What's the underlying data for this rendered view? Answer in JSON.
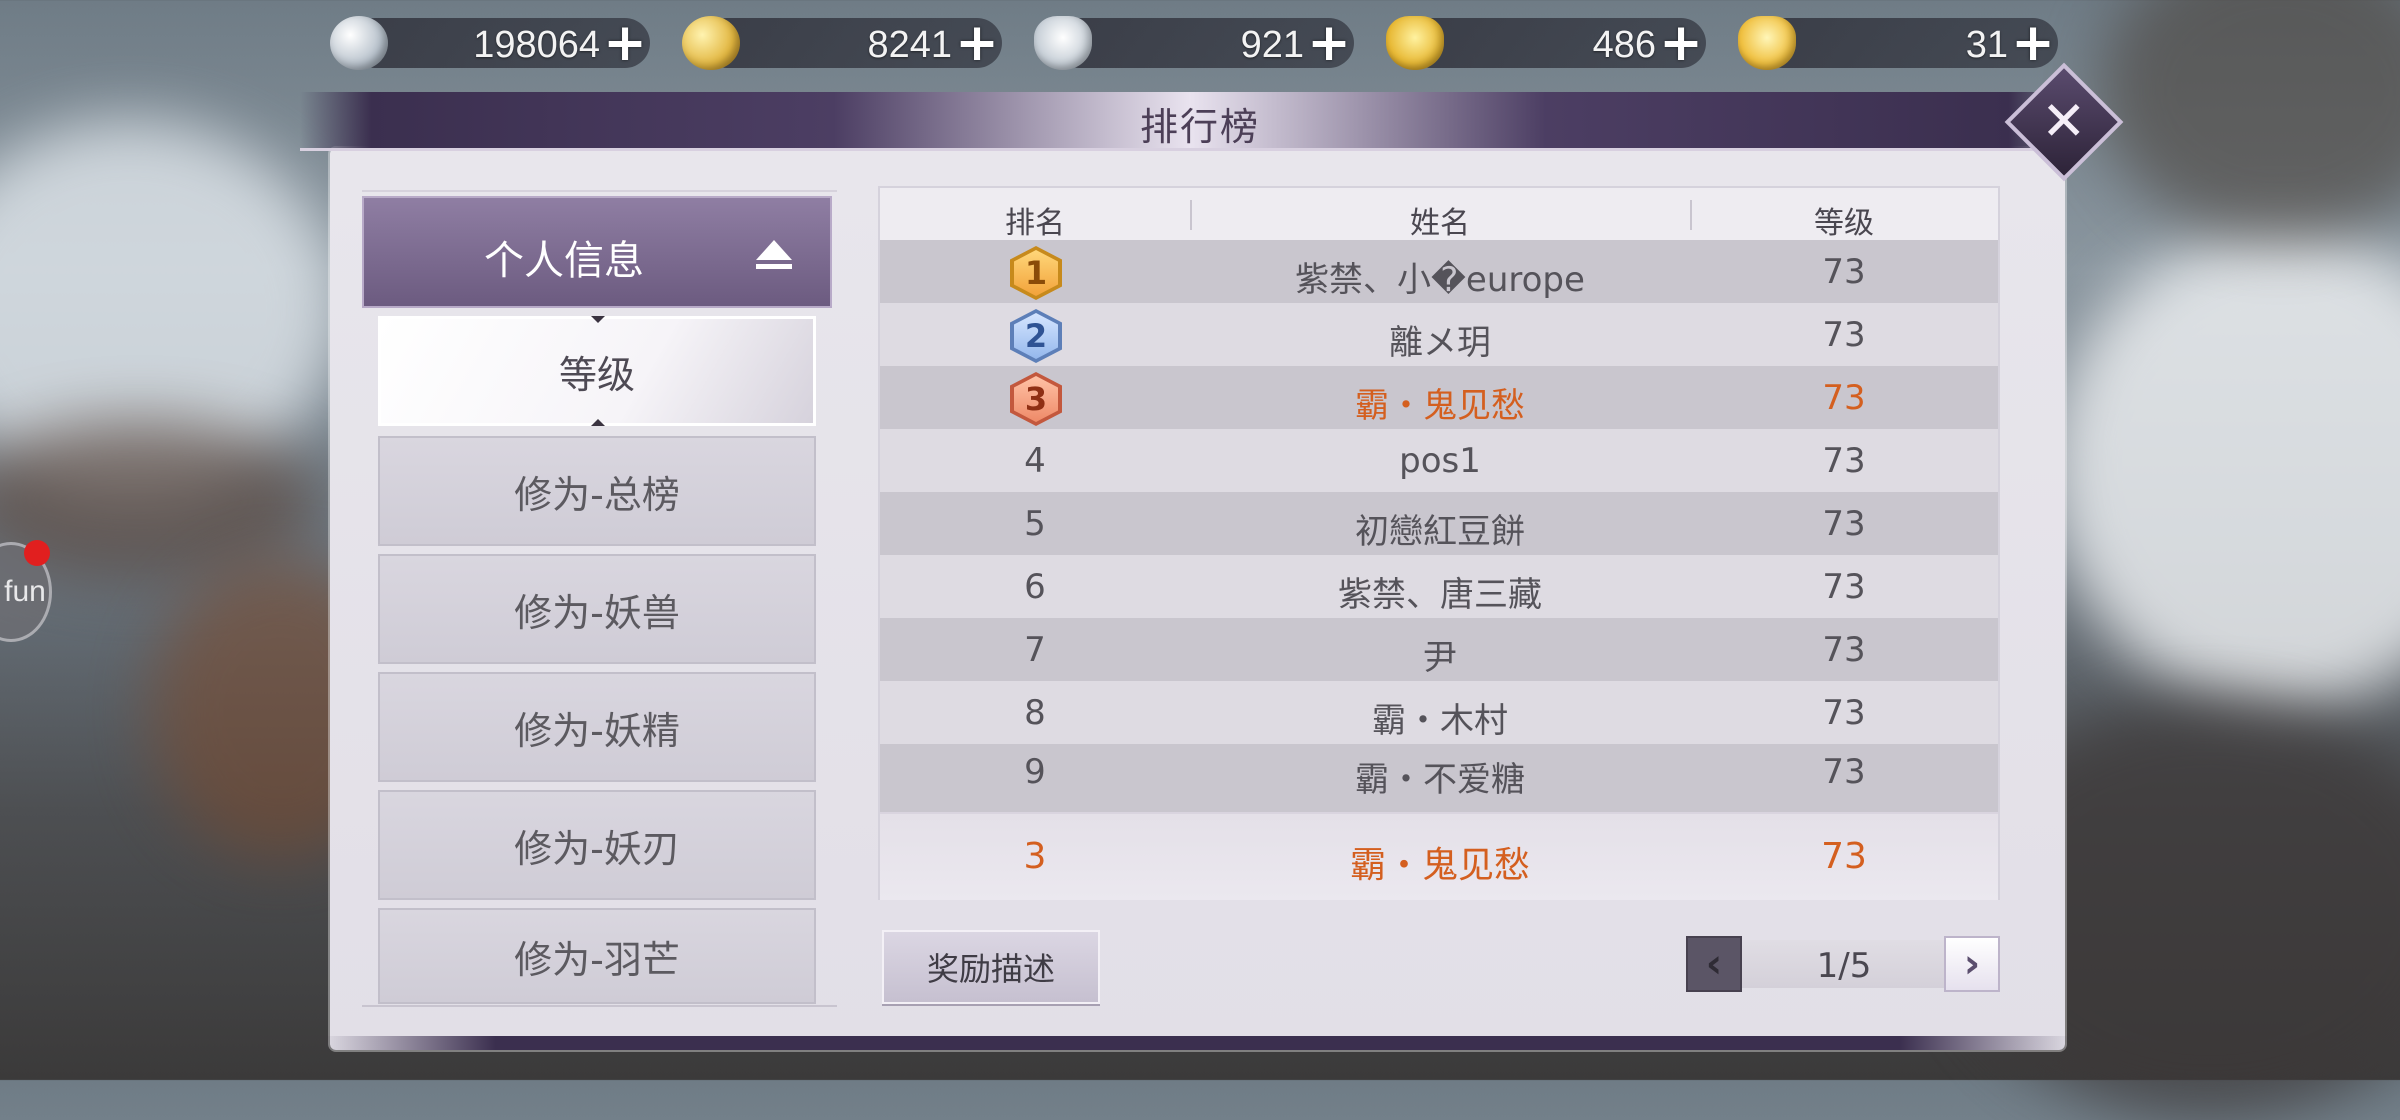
{
  "currencies": [
    {
      "icon": "silver-coin-icon",
      "amount": "198064",
      "add_label": "+"
    },
    {
      "icon": "gold-coin-icon",
      "amount": "8241",
      "add_label": "+"
    },
    {
      "icon": "silver-ingot-icon",
      "amount": "921",
      "add_label": "+"
    },
    {
      "icon": "locked-gold-ingot-icon",
      "amount": "486",
      "add_label": "+"
    },
    {
      "icon": "gold-ingot-icon",
      "amount": "31",
      "add_label": "+"
    }
  ],
  "panel": {
    "title": "排行榜",
    "close_label": "✕"
  },
  "categories": {
    "header": "个人信息",
    "items": [
      "等级",
      "修为-总榜",
      "修为-妖兽",
      "修为-妖精",
      "修为-妖刃",
      "修为-羽芒"
    ],
    "active_index": 0
  },
  "table": {
    "headers": {
      "rank": "排名",
      "name": "姓名",
      "level": "等级"
    },
    "rows": [
      {
        "rank": "1",
        "name": "紫禁、小�europe",
        "level": "73",
        "badge": "gold"
      },
      {
        "rank": "2",
        "name": "離メ玥",
        "level": "73",
        "badge": "blue"
      },
      {
        "rank": "3",
        "name": "霸・鬼见愁",
        "level": "73",
        "badge": "bronze",
        "highlight": true
      },
      {
        "rank": "4",
        "name": "pos1",
        "level": "73"
      },
      {
        "rank": "5",
        "name": "初戀紅豆餅",
        "level": "73"
      },
      {
        "rank": "6",
        "name": "紫禁、唐三藏",
        "level": "73"
      },
      {
        "rank": "7",
        "name": "尹",
        "level": "73"
      },
      {
        "rank": "8",
        "name": "霸・木村",
        "level": "73"
      },
      {
        "rank": "9",
        "name": "霸・不爱糖",
        "level": "73"
      }
    ],
    "self": {
      "rank": "3",
      "name": "霸・鬼见愁",
      "level": "73"
    }
  },
  "controls": {
    "reward_button": "奖励描述",
    "pager": {
      "prev": "‹",
      "next": "›",
      "text": "1/5"
    }
  },
  "side_button": {
    "label": "fun"
  },
  "colors": {
    "highlight": "#d45f1f",
    "panel_bg": "#e8e6ec",
    "header_purple": "#4c3e63"
  }
}
